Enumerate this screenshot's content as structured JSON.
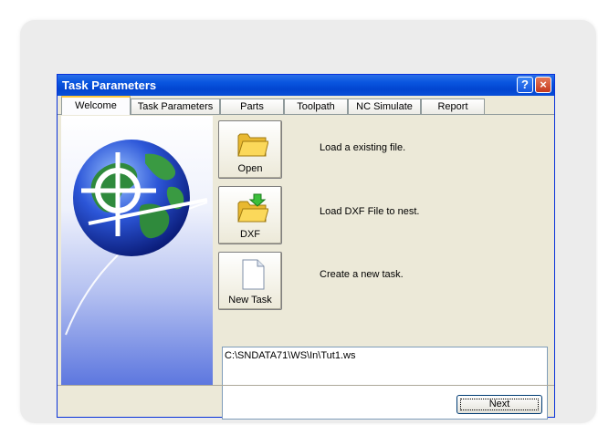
{
  "window": {
    "title": "Task Parameters",
    "help_label": "?",
    "close_label": "×"
  },
  "tabs": [
    "Welcome",
    "Task Parameters",
    "Parts",
    "Toolpath",
    "NC Simulate",
    "Report"
  ],
  "active_tab": "Welcome",
  "actions": [
    {
      "label": "Open",
      "icon": "folder-icon",
      "description": "Load a existing file."
    },
    {
      "label": "DXF",
      "icon": "dxf-folder-icon",
      "description": "Load DXF File to nest."
    },
    {
      "label": "New Task",
      "icon": "new-document-icon",
      "description": "Create a new task."
    }
  ],
  "path_box": {
    "value": "C:\\SNDATA71\\WS\\In\\Tut1.ws"
  },
  "buttons": {
    "next": "Next"
  },
  "colors": {
    "titlebar": "#0a56e0",
    "panel_bottom": "#5d77df"
  }
}
